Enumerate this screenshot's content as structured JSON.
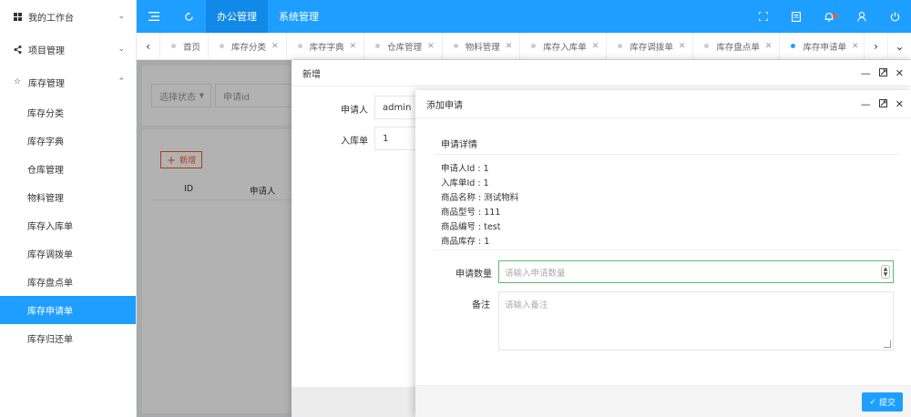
{
  "sidebar": {
    "groups": [
      {
        "label": "我的工作台",
        "icon": "windows-icon",
        "chevron": "⌄"
      },
      {
        "label": "项目管理",
        "icon": "share-icon",
        "chevron": "⌄"
      },
      {
        "label": "库存管理",
        "icon": "star-icon",
        "chevron": "⌃"
      }
    ],
    "items": [
      "库存分类",
      "库存字典",
      "仓库管理",
      "物料管理",
      "库存入库单",
      "库存调拨单",
      "库存盘点单",
      "库存申请单",
      "库存归还单"
    ],
    "active_item": "库存申请单"
  },
  "header": {
    "nav": [
      "办公管理",
      "系统管理"
    ],
    "active_nav": "办公管理"
  },
  "tabs": {
    "items": [
      "首页",
      "库存分类",
      "库存字典",
      "仓库管理",
      "物料管理",
      "库存入库单",
      "库存调拨单",
      "库存盘点单",
      "库存申请单"
    ],
    "active": "库存申请单"
  },
  "background": {
    "select_placeholder": "选择状态",
    "search_placeholder": "申请id",
    "add_button": "新增",
    "table_headers": [
      "ID",
      "申请人"
    ]
  },
  "dialog_add": {
    "title": "新增",
    "fields": [
      {
        "label": "申请人",
        "value": "admin"
      },
      {
        "label": "入库单",
        "value": "1"
      }
    ]
  },
  "dialog_apply": {
    "title": "添加申请",
    "detail_heading": "申请详情",
    "details": [
      "申请人Id : 1",
      "入库单Id : 1",
      "商品名称 : 测试物料",
      "商品型号 : 111",
      "商品编号 : test",
      "商品库存 : 1"
    ],
    "qty_label": "申请数量",
    "qty_placeholder": "请输入申请数量",
    "note_label": "备注",
    "note_placeholder": "请输入备注",
    "submit_label": "提交"
  },
  "colors": {
    "primary": "#1e9fff",
    "danger": "#ff5722",
    "focus": "#5fb878"
  }
}
